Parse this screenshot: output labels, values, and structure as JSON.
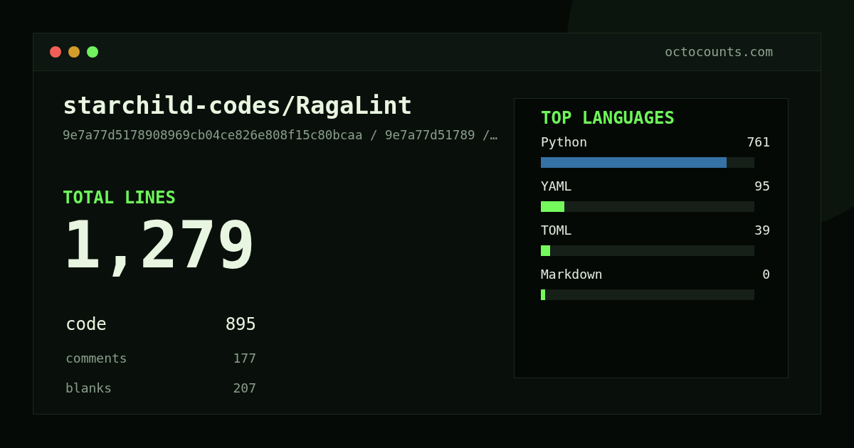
{
  "window": {
    "url": "octocounts.com"
  },
  "repo": {
    "name": "starchild-codes/RagaLint",
    "subtitle": "9e7a77d5178908969cb04ce826e808f15c80bcaa / 9e7a77d51789 /…"
  },
  "total": {
    "label": "TOTAL LINES",
    "value": "1,279"
  },
  "breakdown": [
    {
      "kind": "primary",
      "label": "code",
      "value": "895"
    },
    {
      "kind": "secondary",
      "label": "comments",
      "value": "177"
    },
    {
      "kind": "secondary",
      "label": "blanks",
      "value": "207"
    }
  ],
  "languages": {
    "title": "TOP LANGUAGES",
    "items": [
      {
        "name": "Python",
        "value": "761",
        "level": 0.87,
        "color": "#3572a5"
      },
      {
        "name": "YAML",
        "value": "95",
        "level": 0.11,
        "color": "#74fa5c"
      },
      {
        "name": "TOML",
        "value": "39",
        "level": 0.044,
        "color": "#74fa5c"
      },
      {
        "name": "Markdown",
        "value": "0",
        "level": 0.02,
        "color": "#74fa5c"
      }
    ]
  }
}
